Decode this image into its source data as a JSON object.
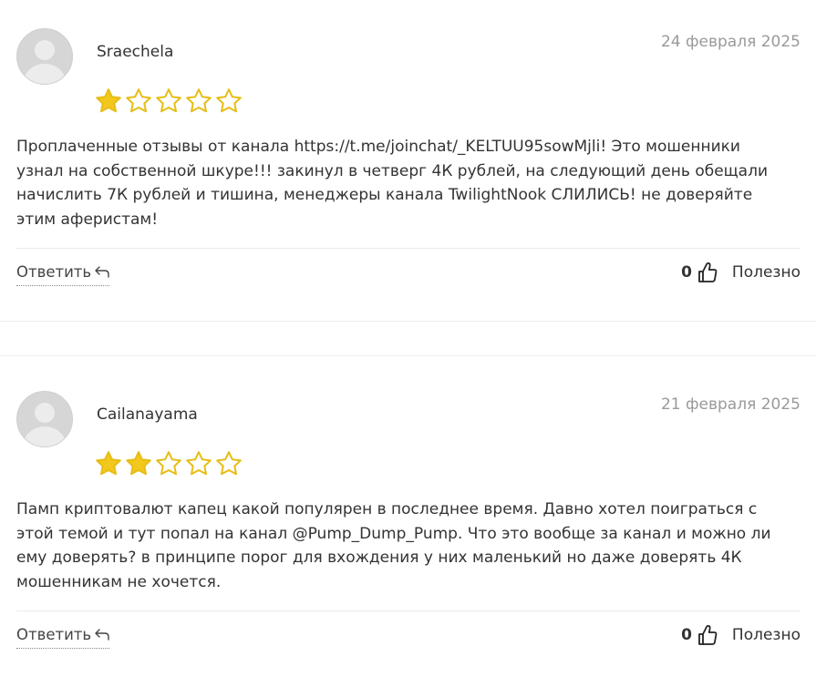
{
  "colors": {
    "star_filled": "#f2c81d",
    "star_outline": "#e7bd16",
    "date_text": "#9a9a9a",
    "body_text": "#333333"
  },
  "reviews": [
    {
      "author": "Sraechela",
      "date": "24 февраля 2025",
      "rating": 1,
      "max_rating": 5,
      "text_lines": [
        "Проплаченные отзывы от канала https://t.me/joinchat/_KELTUU95sowMjli! Это мошенники",
        "узнал на собственной шкуре!!! закинул в четверг 4К рублей, на следующий день обещали",
        "начислить 7К рублей и тишина, менеджеры канала TwilightNook СЛИЛИСЬ! не доверяйте",
        "этим аферистам!"
      ],
      "reply_label": "Ответить",
      "reply_icon": "reply-arrow-icon",
      "helpful_count": "0",
      "helpful_icon": "thumbs-up-icon",
      "helpful_label": "Полезно"
    },
    {
      "author": "Cailanayama",
      "date": "21 февраля 2025",
      "rating": 2,
      "max_rating": 5,
      "text_lines": [
        "Памп криптовалют капец какой популярен в последнее время. Давно хотел поиграться с",
        "этой темой и тут попал на канал @Pump_Dump_Pump. Что это вообще за канал и можно ли",
        "ему доверять? в принципе порог для вхождения у них маленький но даже доверять 4К",
        "мошенникам не хочется."
      ],
      "reply_label": "Ответить",
      "reply_icon": "reply-arrow-icon",
      "helpful_count": "0",
      "helpful_icon": "thumbs-up-icon",
      "helpful_label": "Полезно"
    }
  ]
}
